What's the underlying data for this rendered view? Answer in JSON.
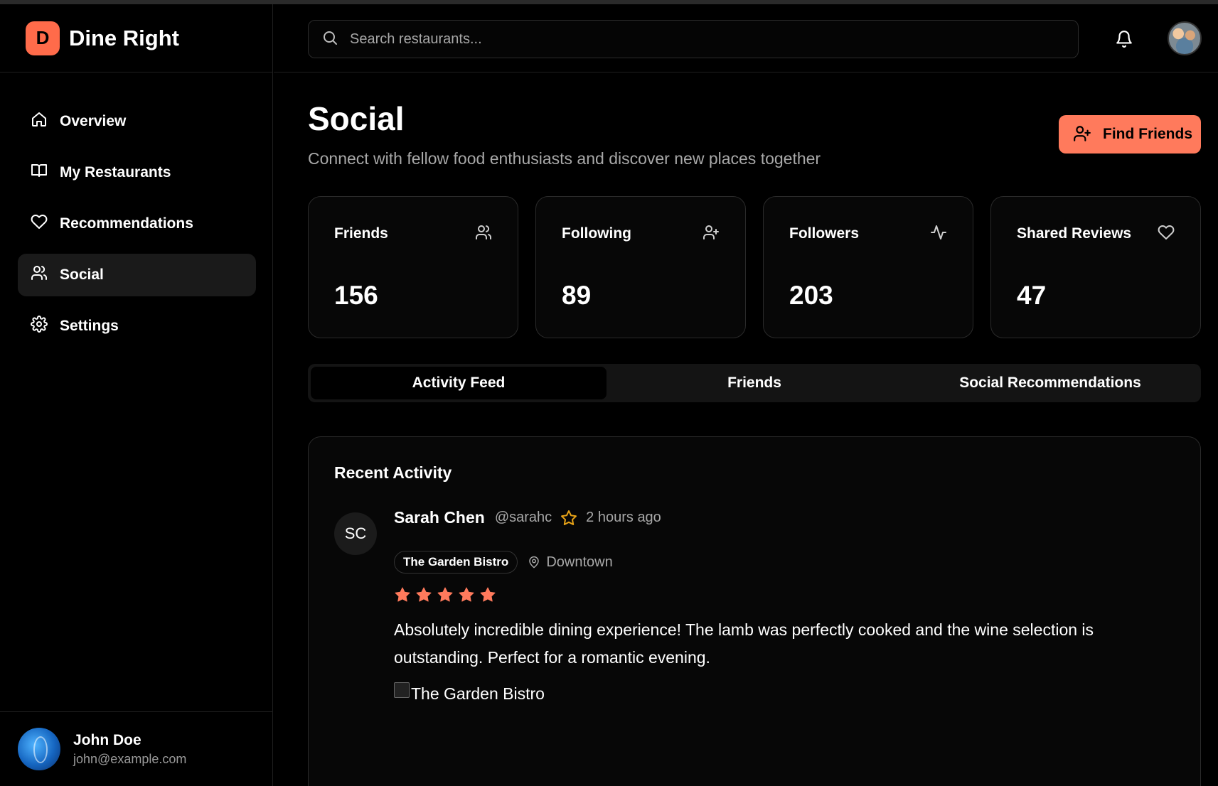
{
  "app": {
    "logo_letter": "D",
    "name": "Dine Right",
    "accent": "#ff7a5c"
  },
  "sidebar": {
    "items": [
      {
        "label": "Overview",
        "icon": "home-icon",
        "active": false
      },
      {
        "label": "My Restaurants",
        "icon": "book-icon",
        "active": false
      },
      {
        "label": "Recommendations",
        "icon": "heart-icon",
        "active": false
      },
      {
        "label": "Social",
        "icon": "users-icon",
        "active": true
      },
      {
        "label": "Settings",
        "icon": "gear-icon",
        "active": false
      }
    ],
    "user": {
      "name": "John Doe",
      "email": "john@example.com"
    }
  },
  "header": {
    "search_placeholder": "Search restaurants..."
  },
  "page": {
    "title": "Social",
    "subtitle": "Connect with fellow food enthusiasts and discover new places together",
    "find_friends_label": "Find Friends"
  },
  "stats": [
    {
      "label": "Friends",
      "value": "156",
      "icon": "users-icon"
    },
    {
      "label": "Following",
      "value": "89",
      "icon": "user-plus-icon"
    },
    {
      "label": "Followers",
      "value": "203",
      "icon": "activity-icon"
    },
    {
      "label": "Shared Reviews",
      "value": "47",
      "icon": "heart-icon"
    }
  ],
  "tabs": [
    {
      "label": "Activity Feed",
      "active": true
    },
    {
      "label": "Friends",
      "active": false
    },
    {
      "label": "Social Recommendations",
      "active": false
    }
  ],
  "activity": {
    "section_title": "Recent Activity",
    "items": [
      {
        "initials": "SC",
        "name": "Sarah Chen",
        "handle": "@sarahc",
        "time": "2 hours ago",
        "restaurant": "The Garden Bistro",
        "location": "Downtown",
        "rating": 5,
        "review": "Absolutely incredible dining experience! The lamb was perfectly cooked and the wine selection is outstanding. Perfect for a romantic evening.",
        "image_alt": "The Garden Bistro"
      }
    ]
  }
}
